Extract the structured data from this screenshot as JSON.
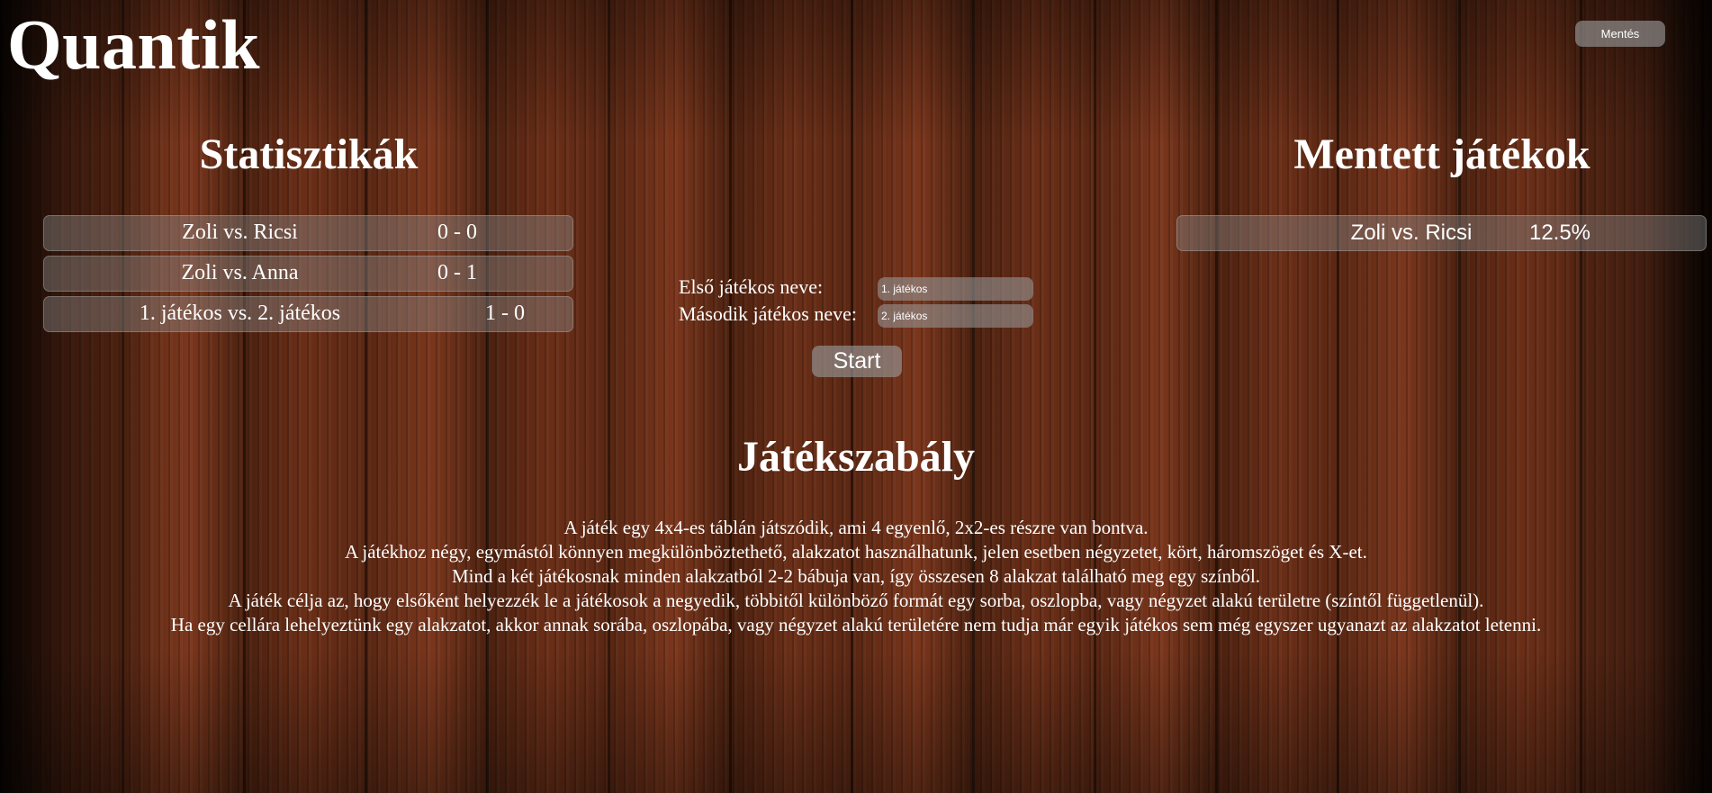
{
  "header": {
    "title": "Quantik",
    "save_label": "Mentés"
  },
  "stats": {
    "heading": "Statisztikák",
    "rows": [
      {
        "names": "Zoli vs. Ricsi",
        "score": "0 - 0"
      },
      {
        "names": "Zoli vs. Anna",
        "score": "0 - 1"
      },
      {
        "names": "1. játékos vs. 2. játékos",
        "score": "1 - 0"
      }
    ]
  },
  "saved_games": {
    "heading": "Mentett játékok",
    "rows": [
      {
        "names": "Zoli vs. Ricsi",
        "progress": "12.5%"
      }
    ]
  },
  "form": {
    "player1_label": "Első játékos neve:",
    "player1_value": "1. játékos",
    "player2_label": "Második játékos neve:",
    "player2_value": "2. játékos",
    "start_label": "Start"
  },
  "rules": {
    "heading": "Játékszabály",
    "lines": [
      "A játék egy 4x4-es táblán játszódik, ami 4 egyenlő, 2x2-es részre van bontva.",
      "A játékhoz négy, egymástól könnyen megkülönböztethető, alakzatot használhatunk, jelen esetben négyzetet, kört, háromszöget és X-et.",
      "Mind a két játékosnak minden alakzatból 2-2 bábuja van, így összesen 8 alakzat található meg egy színből.",
      "A játék célja az, hogy elsőként helyezzék le a játékosok a negyedik, többitől különböző formát egy sorba, oszlopba, vagy négyzet alakú területre (színtől függetlenül).",
      "Ha egy cellára lehelyeztünk egy alakzatot, akkor annak sorába, oszlopába, vagy négyzet alakú területére nem tudja már egyik játékos sem még egyszer ugyanazt az alakzatot letenni."
    ]
  }
}
